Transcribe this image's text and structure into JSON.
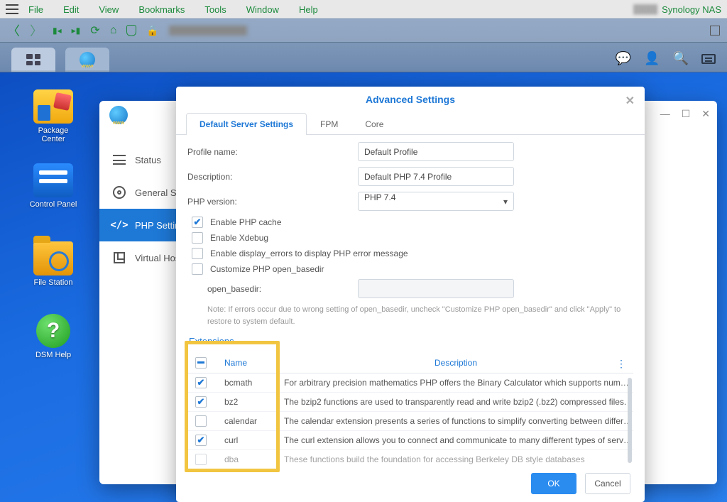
{
  "browser": {
    "menu": {
      "file": "File",
      "edit": "Edit",
      "view": "View",
      "bookmarks": "Bookmarks",
      "tools": "Tools",
      "window": "Window",
      "help": "Help"
    },
    "page_title_right": "Synology NAS"
  },
  "taskbar_icons": {
    "chat": "💬",
    "user": "👤",
    "search": "🔍"
  },
  "desktop_icons": {
    "package_center": "Package\nCenter",
    "control_panel": "Control Panel",
    "file_station": "File Station",
    "dsm_help": "DSM Help"
  },
  "webstation_sidebar": {
    "status": "Status",
    "general": "General Settings",
    "php": "PHP Settings",
    "vhost": "Virtual Host"
  },
  "window_controls": {
    "min": "—",
    "max": "☐",
    "close": "✕"
  },
  "modal": {
    "title": "Advanced Settings",
    "tabs": {
      "default": "Default Server Settings",
      "fpm": "FPM",
      "core": "Core"
    },
    "fields": {
      "profile_label": "Profile name:",
      "profile_value": "Default Profile",
      "desc_label": "Description:",
      "desc_value": "Default PHP 7.4 Profile",
      "ver_label": "PHP version:",
      "ver_value": "PHP 7.4"
    },
    "checks": {
      "cache": "Enable PHP cache",
      "xdebug": "Enable Xdebug",
      "display_errors": "Enable display_errors to display PHP error message",
      "open_basedir": "Customize PHP open_basedir",
      "open_basedir_label": "open_basedir:"
    },
    "note": "Note: If errors occur due to wrong setting of open_basedir, uncheck \"Customize PHP open_basedir\" and click \"Apply\" to restore to system default.",
    "extensions_title": "Extensions",
    "ext_headers": {
      "name": "Name",
      "desc": "Description"
    },
    "ext_rows": [
      {
        "checked": true,
        "name": "bcmath",
        "desc": "For arbitrary precision mathematics PHP offers the Binary Calculator which supports numbe…"
      },
      {
        "checked": true,
        "name": "bz2",
        "desc": "The bzip2 functions are used to transparently read and write bzip2 (.bz2) compressed files."
      },
      {
        "checked": false,
        "name": "calendar",
        "desc": "The calendar extension presents a series of functions to simplify converting between differe…"
      },
      {
        "checked": true,
        "name": "curl",
        "desc": "The curl extension allows you to connect and communicate to many different types of serve…"
      },
      {
        "checked": false,
        "name": "dba",
        "desc": "These functions build the foundation for accessing Berkeley DB style databases"
      }
    ],
    "buttons": {
      "ok": "OK",
      "cancel": "Cancel"
    }
  }
}
